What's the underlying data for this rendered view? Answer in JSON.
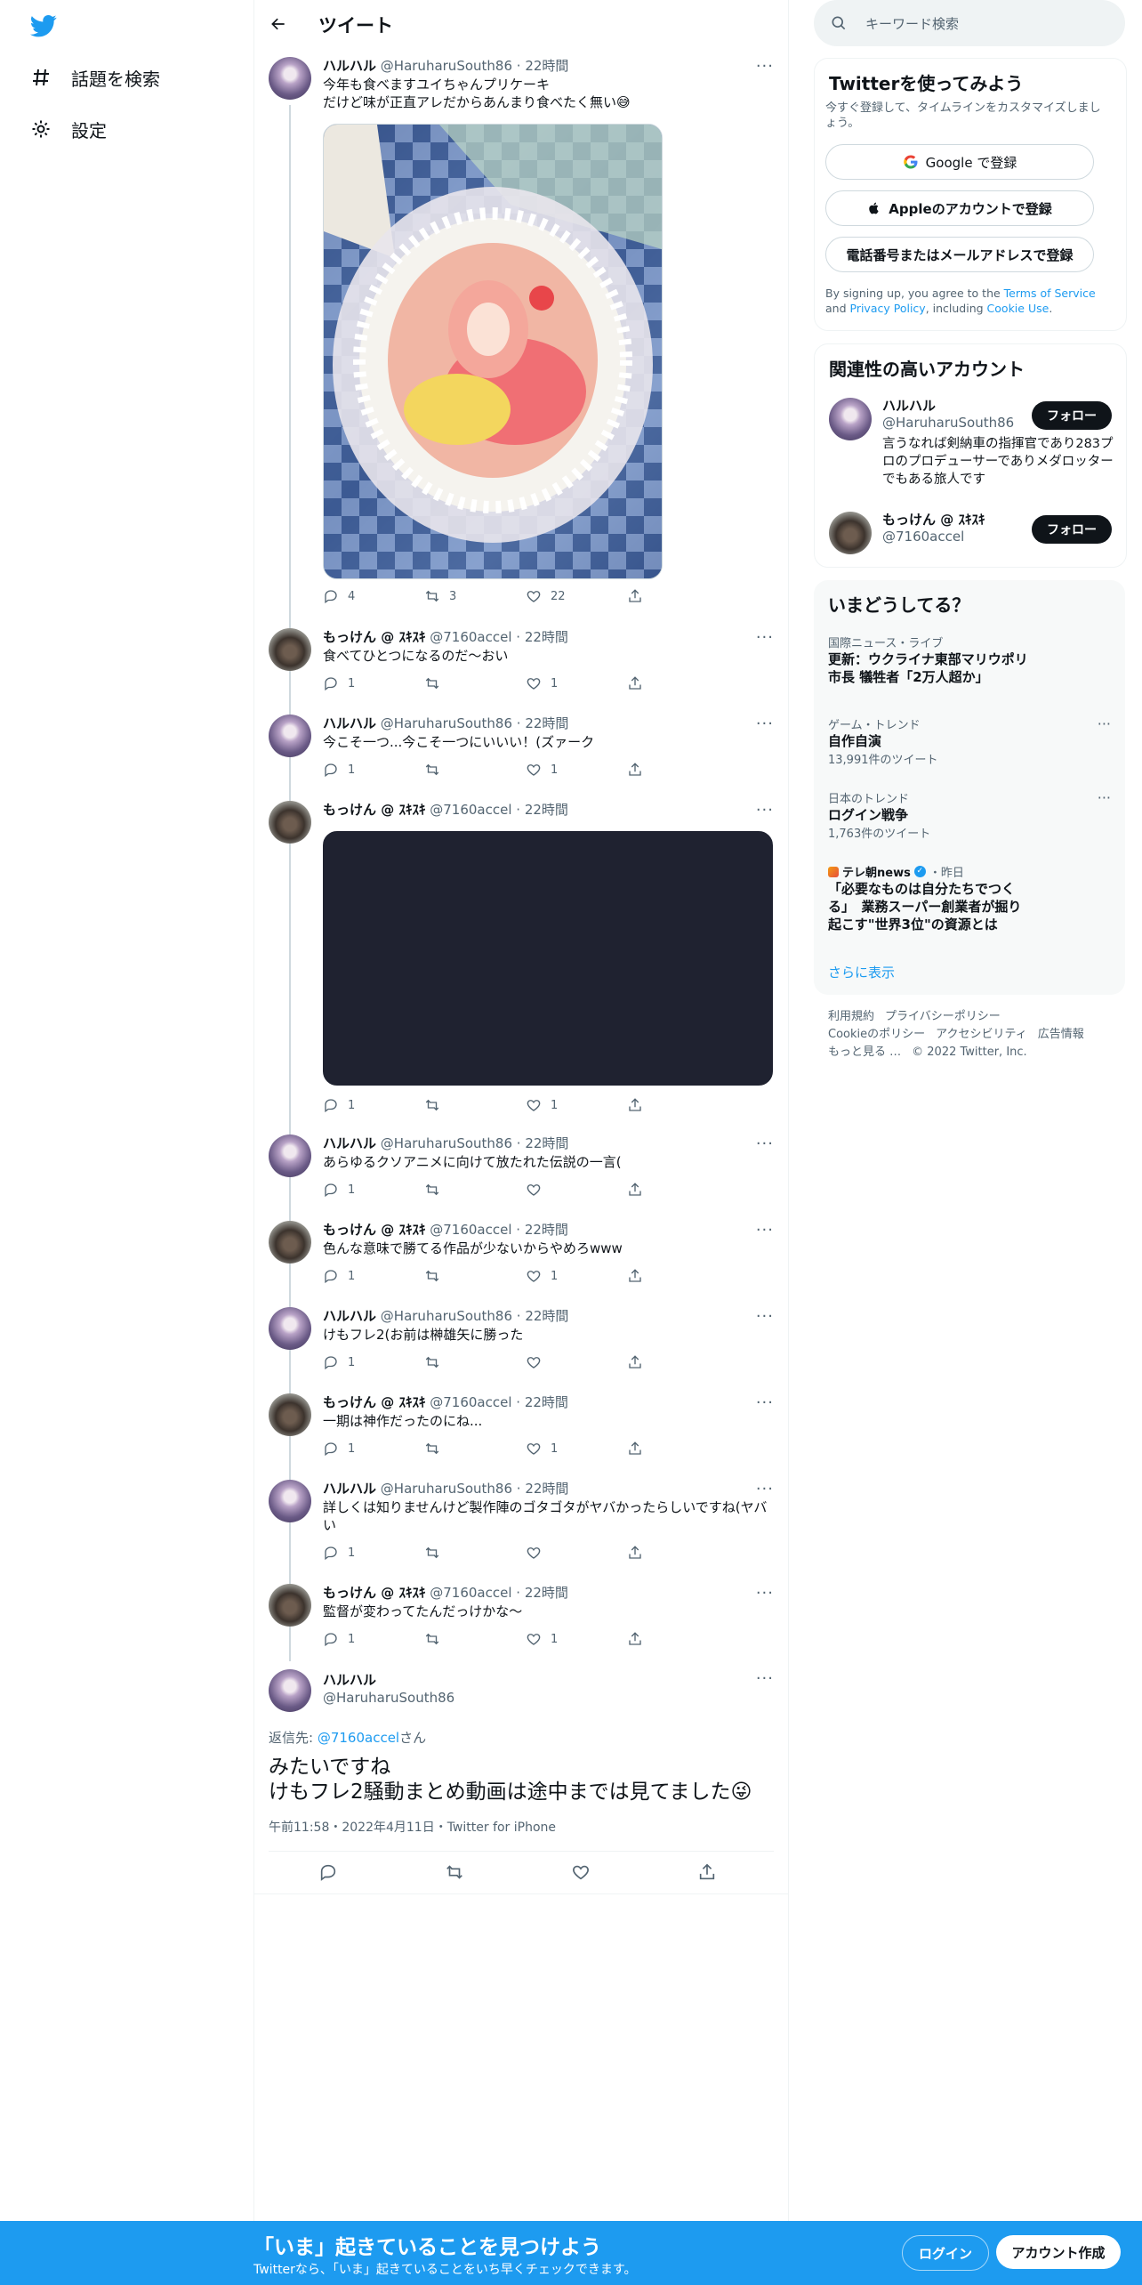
{
  "nav": {
    "explore_label": "話題を検索",
    "settings_label": "設定"
  },
  "header": {
    "title": "ツイート"
  },
  "tweets": [
    {
      "name": "ハルハル",
      "handle": "@HaruharuSouth86",
      "time": "22時間",
      "text1": "今年も食べますユイちゃんプリケーキ",
      "text2": "だけど味が正直アレだからあんまり食べたく無い😅",
      "replies": "4",
      "retweets": "3",
      "likes": "22"
    },
    {
      "name": "もっけん @ ｽｷｽｷ",
      "handle": "@7160accel",
      "time": "22時間",
      "text": "食べてひとつになるのだ～おい",
      "replies": "1",
      "retweets": "",
      "likes": "1"
    },
    {
      "name": "ハルハル",
      "handle": "@HaruharuSouth86",
      "time": "22時間",
      "text": "今こそ一つ...今こそ一つにいいい！(ズァーク",
      "replies": "1",
      "retweets": "",
      "likes": "1"
    },
    {
      "name": "もっけん @ ｽｷｽｷ",
      "handle": "@7160accel",
      "time": "22時間",
      "text": "",
      "replies": "1",
      "retweets": "",
      "likes": "1"
    },
    {
      "name": "ハルハル",
      "handle": "@HaruharuSouth86",
      "time": "22時間",
      "text": "あらゆるクソアニメに向けて放たれた伝説の一言(",
      "replies": "1",
      "retweets": "",
      "likes": ""
    },
    {
      "name": "もっけん @ ｽｷｽｷ",
      "handle": "@7160accel",
      "time": "22時間",
      "text": "色んな意味で勝てる作品が少ないからやめろwww",
      "replies": "1",
      "retweets": "",
      "likes": "1"
    },
    {
      "name": "ハルハル",
      "handle": "@HaruharuSouth86",
      "time": "22時間",
      "text": "けもフレ2(お前は榊雄矢に勝った",
      "replies": "1",
      "retweets": "",
      "likes": ""
    },
    {
      "name": "もっけん @ ｽｷｽｷ",
      "handle": "@7160accel",
      "time": "22時間",
      "text": "一期は神作だったのにね...",
      "replies": "1",
      "retweets": "",
      "likes": "1"
    },
    {
      "name": "ハルハル",
      "handle": "@HaruharuSouth86",
      "time": "22時間",
      "text1": "詳しくは知りませんけど製作陣のゴタゴタがヤバかったらしいですね(ヤバ",
      "text2": "い",
      "replies": "1",
      "retweets": "",
      "likes": ""
    },
    {
      "name": "もっけん @ ｽｷｽｷ",
      "handle": "@7160accel",
      "time": "22時間",
      "text": "監督が変わってたんだっけかな〜",
      "replies": "1",
      "retweets": "",
      "likes": "1"
    }
  ],
  "focused": {
    "name": "ハルハル",
    "handle": "@HaruharuSouth86",
    "reply_prefix": "返信先: ",
    "reply_to": "@7160accel",
    "reply_suffix": "さん",
    "text1": "みたいですね",
    "text2": "けもフレ2騒動まとめ動画は途中までは見てました😜",
    "meta": "午前11:58・2022年4月11日・Twitter for iPhone"
  },
  "search": {
    "placeholder": "キーワード検索"
  },
  "signup_card": {
    "title": "Twitterを使ってみよう",
    "subtitle": "今すぐ登録して、タイムラインをカスタマイズしましょう。",
    "google": "Google で登録",
    "apple": "Appleのアカウントで登録",
    "phone": "電話番号またはメールアドレスで登録",
    "legal_1": "By signing up, you agree to the ",
    "terms": "Terms of Service",
    "legal_2": " and ",
    "privacy": "Privacy Policy",
    "legal_3": ", including ",
    "cookie": "Cookie Use",
    "legal_4": "."
  },
  "related": {
    "title": "関連性の高いアカウント",
    "accounts": [
      {
        "name": "ハルハル",
        "handle": "@HaruharuSouth86",
        "bio": "言うなれば剣納車の指揮官であり283プロのプロデューサーでありメダロッターでもある旅人です",
        "button": "フォロー"
      },
      {
        "name": "もっけん @ ｽｷｽｷ",
        "handle": "@7160accel",
        "bio": "",
        "button": "フォロー"
      }
    ]
  },
  "trends": {
    "title": "いまどうしてる？",
    "items": [
      {
        "meta": "国際ニュース・ライブ",
        "title1": "更新：ウクライナ東部マリウポリ",
        "title2": "市長 犠牲者「2万人超か」",
        "count": ""
      },
      {
        "meta": "ゲーム・トレンド",
        "title1": "自作自演",
        "title2": "",
        "count": "13,991件のツイート"
      },
      {
        "meta": "日本のトレンド",
        "title1": "ログイン戦争",
        "title2": "",
        "count": "1,763件のツイート"
      },
      {
        "meta_source": "テレ朝news",
        "meta_time": "・昨日",
        "title1": "「必要なものは自分たちでつく",
        "title2": "る」　業務スーパー創業者が掘り",
        "title3": "起こす\"世界3位\"の資源とは"
      }
    ],
    "show_more": "さらに表示"
  },
  "footer": {
    "links": [
      "利用規約",
      "プライバシーポリシー",
      "Cookieのポリシー",
      "アクセシビリティ",
      "広告情報",
      "もっと見る …"
    ],
    "copyright": "© 2022 Twitter, Inc."
  },
  "bottom_bar": {
    "title": "「いま」起きていることを見つけよう",
    "subtitle": "Twitterなら、「いま」起きていることをいち早くチェックできます。",
    "login": "ログイン",
    "signup": "アカウント作成"
  },
  "colors": {
    "accent": "#1d9bf0",
    "text": "#0f1419",
    "muted": "#536471"
  }
}
